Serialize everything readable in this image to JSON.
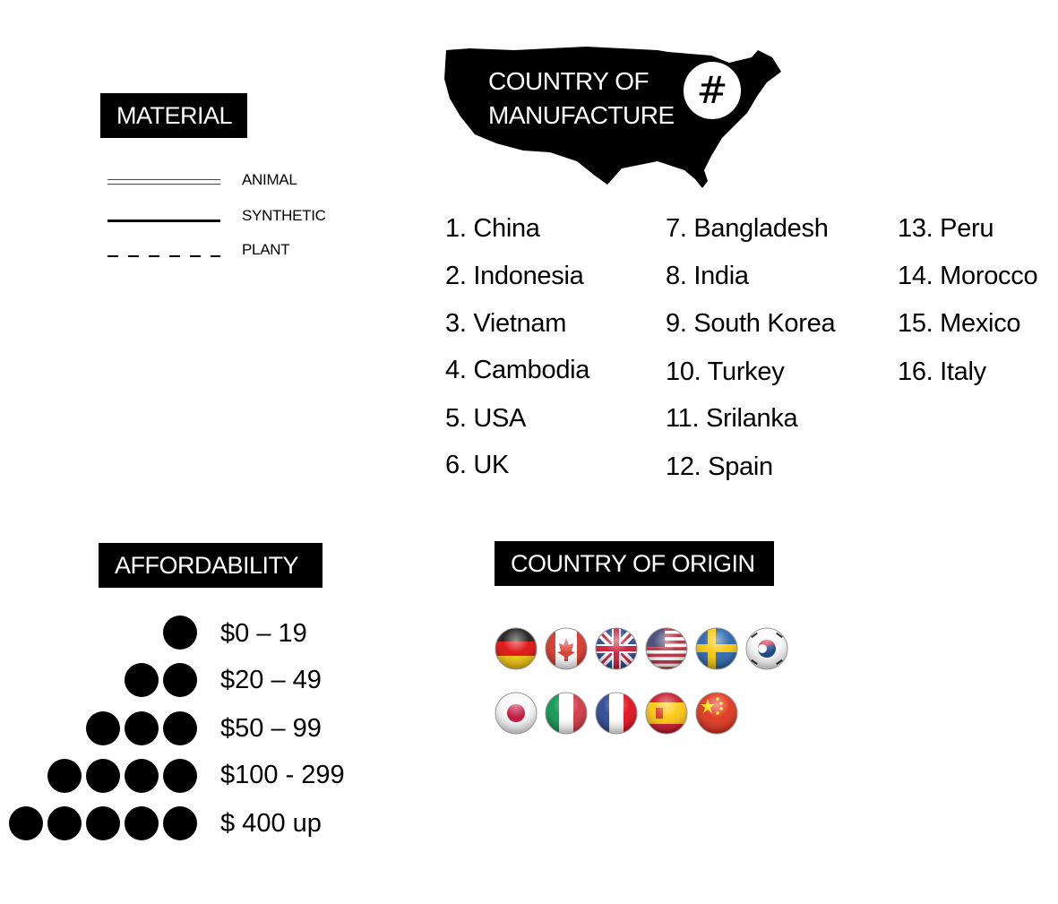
{
  "material": {
    "title": "MATERIAL",
    "legend": [
      {
        "label": "ANIMAL",
        "style": "double"
      },
      {
        "label": "SYNTHETIC",
        "style": "solid"
      },
      {
        "label": "PLANT",
        "style": "dashed"
      }
    ]
  },
  "manufacture": {
    "title_line1": "COUNTRY OF",
    "title_line2": "MANUFACTURE",
    "badge": "#",
    "columns": [
      [
        "1. China",
        "2. Indonesia",
        "3. Vietnam",
        "4. Cambodia",
        "5. USA",
        "6. UK"
      ],
      [
        "7. Bangladesh",
        "8. India",
        "9. South Korea",
        "10. Turkey",
        "11. Srilanka",
        "12. Spain"
      ],
      [
        "13. Peru",
        "14. Morocco",
        "15. Mexico",
        "16. Italy"
      ]
    ]
  },
  "affordability": {
    "title": "AFFORDABILITY",
    "tiers": [
      {
        "dots": 1,
        "label": "$0 – 19"
      },
      {
        "dots": 2,
        "label": "$20 – 49"
      },
      {
        "dots": 3,
        "label": "$50 – 99"
      },
      {
        "dots": 4,
        "label": "$100 - 299"
      },
      {
        "dots": 5,
        "label": "$ 400 up"
      }
    ]
  },
  "origin": {
    "title": "COUNTRY OF ORIGIN",
    "flags_row1": [
      "germany-flag-icon",
      "canada-flag-icon",
      "uk-flag-icon",
      "usa-flag-icon",
      "sweden-flag-icon",
      "south-korea-flag-icon"
    ],
    "flags_row2": [
      "japan-flag-icon",
      "italy-flag-icon",
      "france-flag-icon",
      "spain-flag-icon",
      "china-flag-icon"
    ]
  }
}
